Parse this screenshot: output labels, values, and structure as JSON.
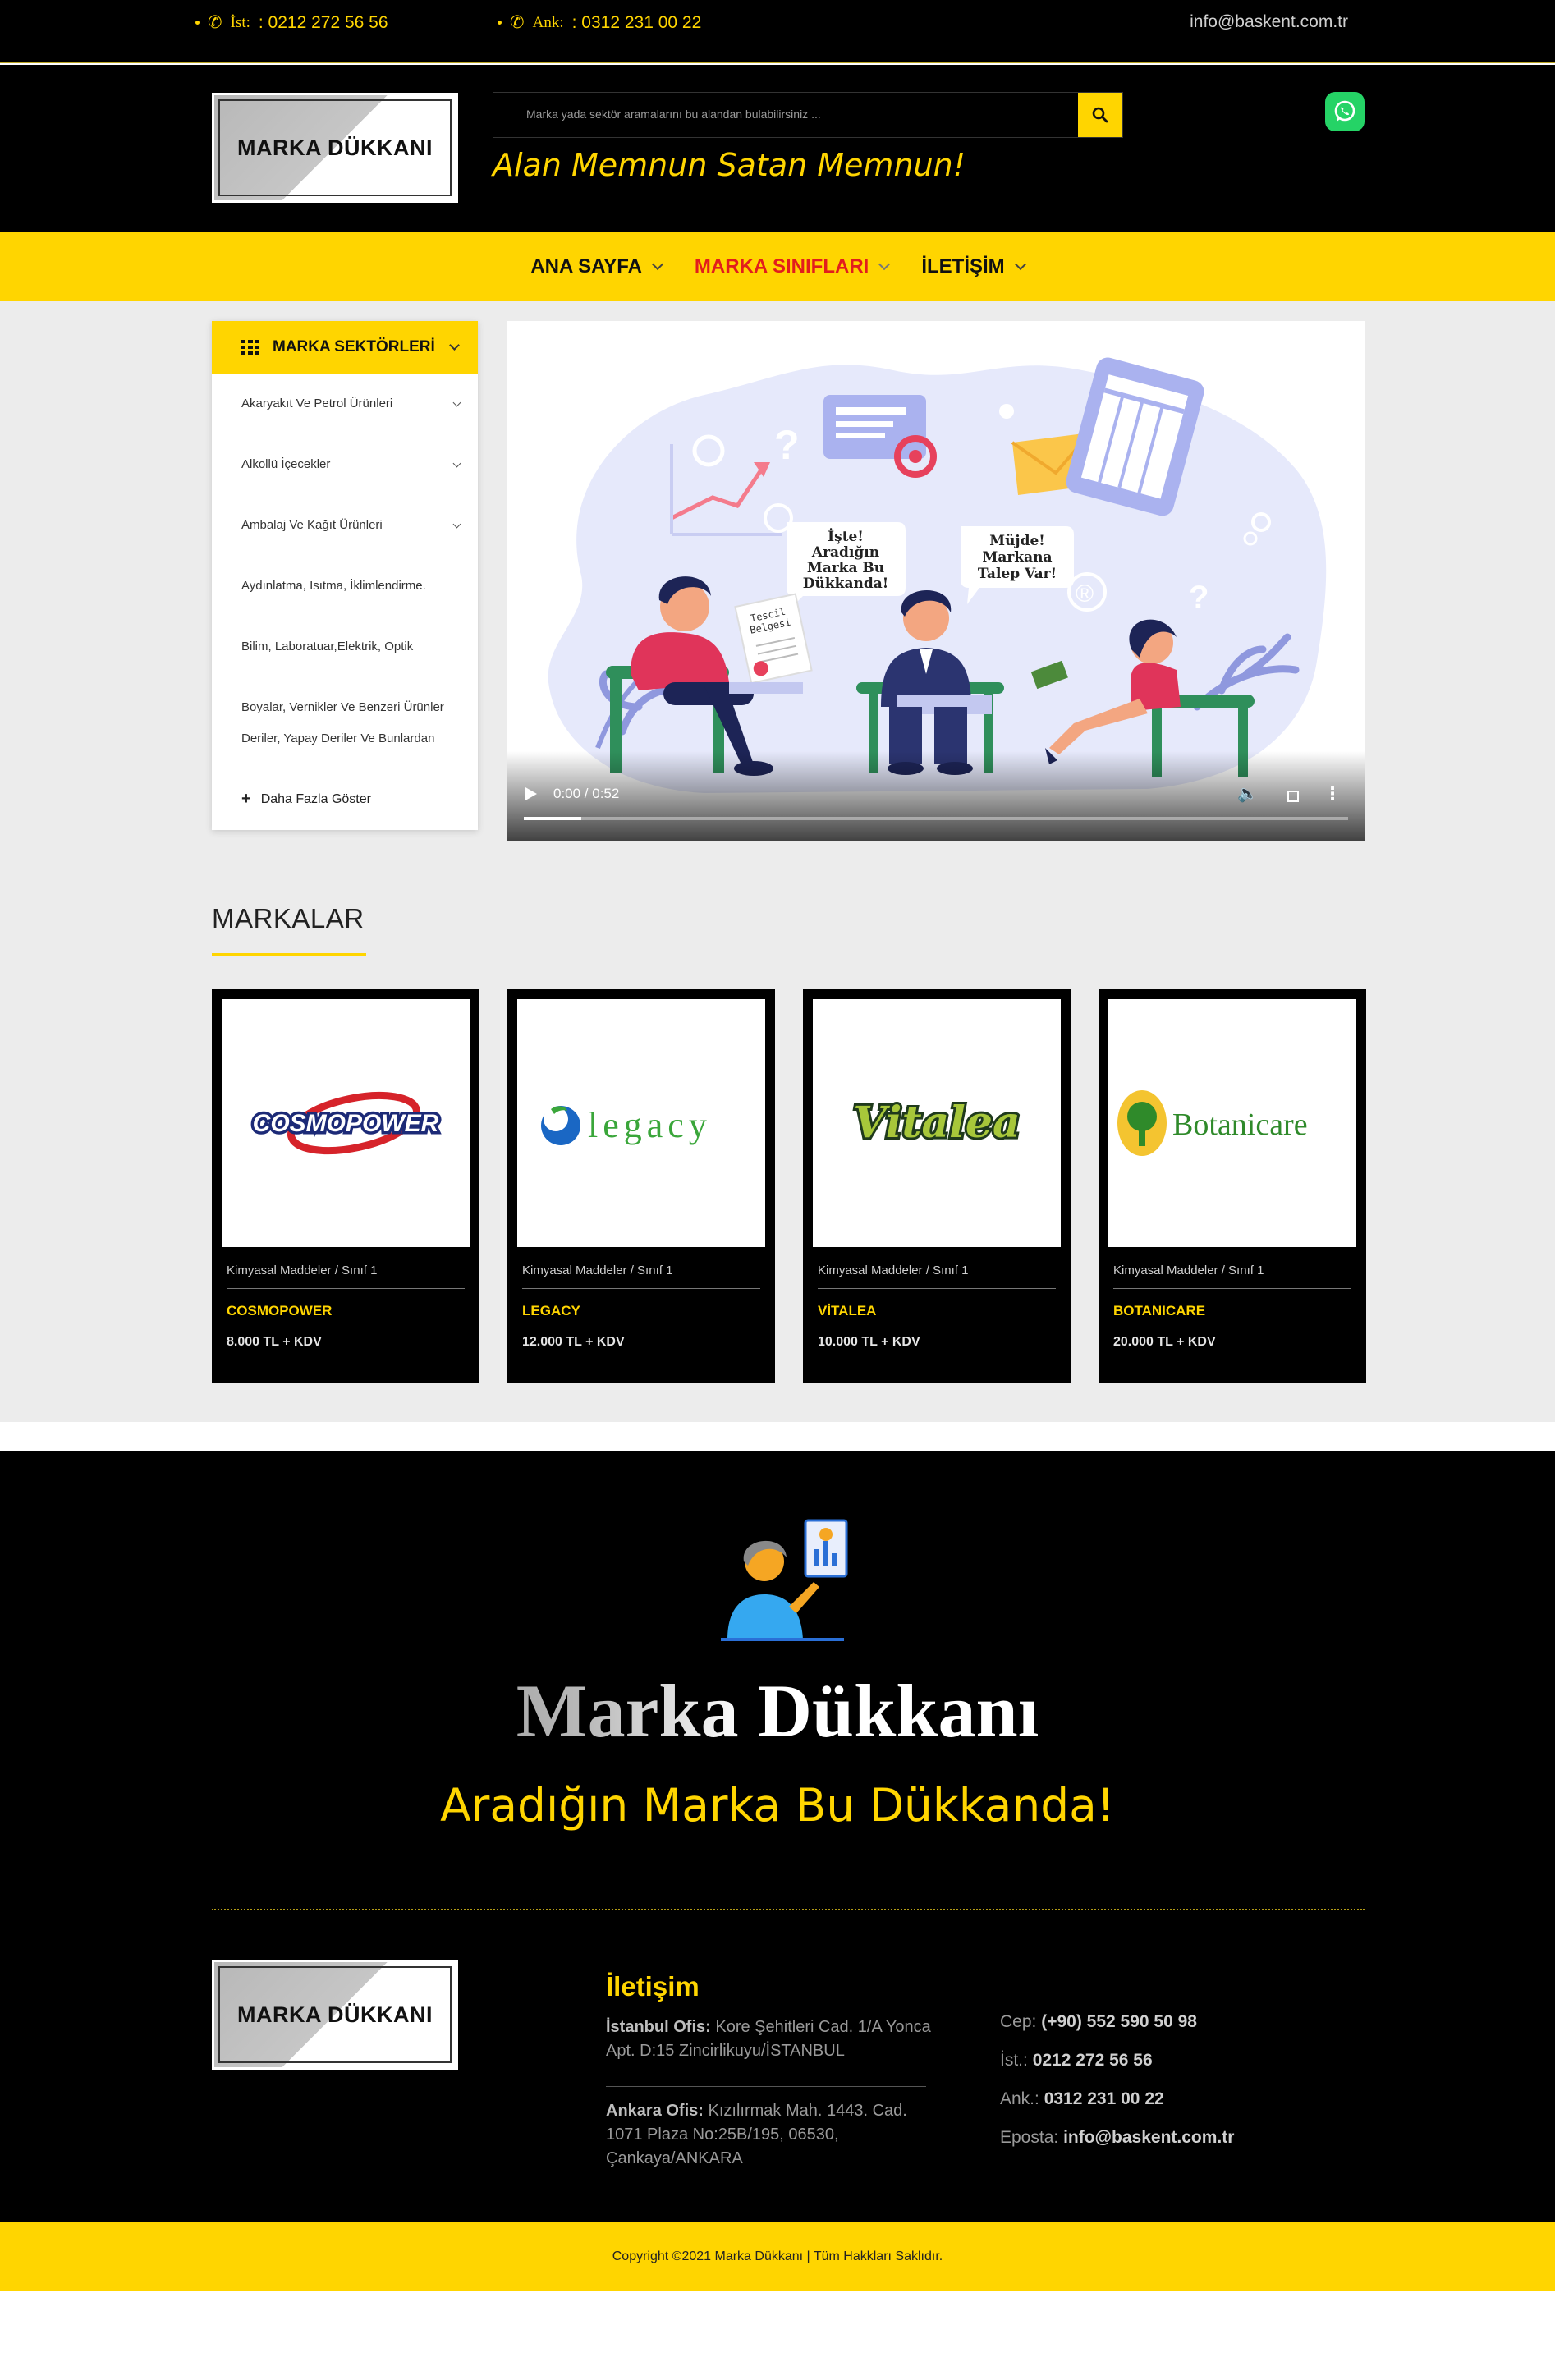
{
  "topbar": {
    "phone1_label": "İst:",
    "phone1": ": 0212 272 56 56",
    "phone2_label": "Ank:",
    "phone2": ": 0312 231 00 22",
    "email": "info@baskent.com.tr"
  },
  "header": {
    "logo_text": "MARKA DÜKKANI",
    "search_placeholder": "Marka yada sektör aramalarını bu alandan bulabilirsiniz ...",
    "slogan": "Alan Memnun Satan Memnun!"
  },
  "nav": {
    "items": [
      {
        "label": "ANA SAYFA"
      },
      {
        "label": "MARKA SINIFLARI"
      },
      {
        "label": "İLETİŞİM"
      }
    ]
  },
  "sectors": {
    "title": "MARKA SEKTÖRLERİ",
    "items": [
      "Akaryakıt Ve Petrol Ürünleri",
      "Alkollü İçecekler",
      "Ambalaj Ve Kağıt Ürünleri",
      "Aydınlatma, Isıtma, İklimlendirme.",
      "Bilim, Laboratuar,Elektrik, Optik",
      "Boyalar, Vernikler Ve Benzeri Ürünler",
      "Deriler, Yapay Deriler Ve Bunlardan"
    ],
    "more": "Daha Fazla Göster"
  },
  "video": {
    "time": "0:00 / 0:52",
    "bubble1": [
      "İşte!",
      "Aradığın",
      "Marka Bu",
      "Dükkanda!"
    ],
    "bubble2": [
      "Müjde!",
      "Markana",
      "Talep Var!"
    ],
    "doc_label": [
      "Tescil",
      "Belgesi"
    ]
  },
  "brands": {
    "title": "MARKALAR",
    "items": [
      {
        "category": "Kimyasal Maddeler / Sınıf 1",
        "name": "COSMOPOWER",
        "price": "8.000 TL + KDV",
        "logo_text": "COSMOPOWER"
      },
      {
        "category": "Kimyasal Maddeler / Sınıf 1",
        "name": "LEGACY",
        "price": "12.000 TL + KDV",
        "logo_text": "legacy"
      },
      {
        "category": "Kimyasal Maddeler / Sınıf 1",
        "name": "VİTALEA",
        "price": "10.000 TL + KDV",
        "logo_text": "Vitalea"
      },
      {
        "category": "Kimyasal Maddeler / Sınıf 1",
        "name": "BOTANICARE",
        "price": "20.000 TL + KDV",
        "logo_text": "Botanicare"
      }
    ]
  },
  "footer": {
    "brand": "Marka Dükkanı",
    "tagline": "Aradığın Marka Bu Dükkanda!",
    "logo_text": "MARKA DÜKKANI",
    "contact_title": "İletişim",
    "istanbul_label": "İstanbul Ofis:",
    "istanbul_addr": "Kore Şehitleri Cad. 1/A Yonca Apt. D:15 Zincirlikuyu/İSTANBUL",
    "ankara_label": "Ankara Ofis:",
    "ankara_addr": "Kızılırmak Mah. 1443. Cad. 1071 Plaza No:25B/195, 06530, Çankaya/ANKARA",
    "cep_label": "Cep:",
    "cep": "(+90) 552 590 50 98",
    "ist_label": "İst.:",
    "ist": "0212 272 56 56",
    "ank_label": "Ank.:",
    "ank": "0312 231 00 22",
    "eposta_label": "Eposta:",
    "eposta": "info@baskent.com.tr",
    "copyright": "Copyright ©2021 Marka Dükkanı | Tüm Hakkları Saklıdır."
  },
  "colors": {
    "accent": "#ffd500",
    "active_nav": "#e21d1d",
    "background_dark": "#000000",
    "background_grey": "#ececec"
  }
}
